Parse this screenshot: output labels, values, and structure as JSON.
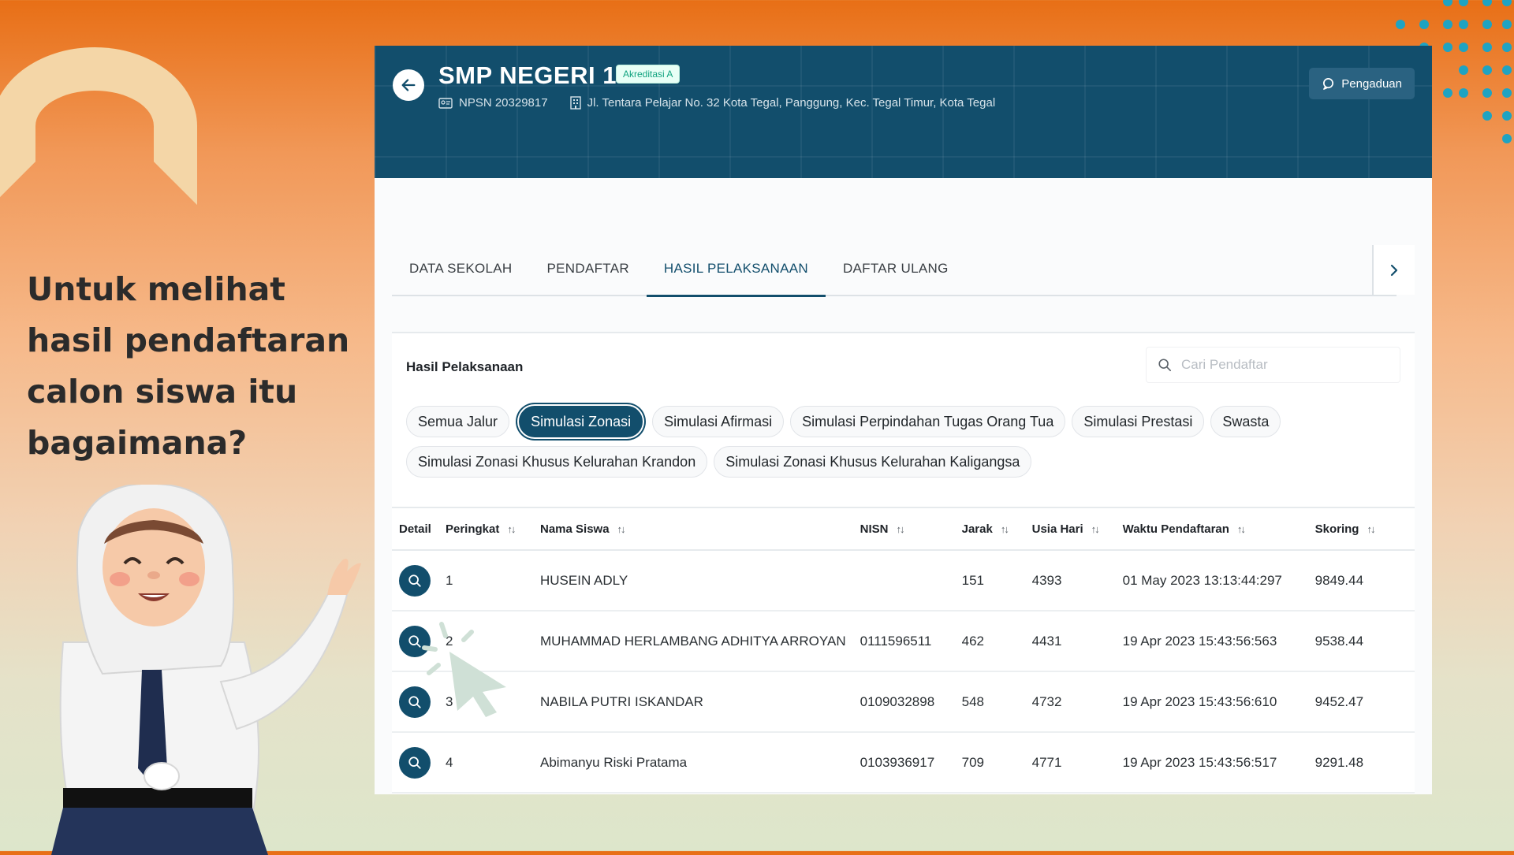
{
  "slide": {
    "headline": "Untuk melihat hasil pendaftaran calon siswa itu bagaimana?"
  },
  "header": {
    "school_name": "SMP NEGERI 1",
    "accreditation": "Akreditasi A",
    "npsn": "NPSN 20329817",
    "address": "Jl. Tentara Pelajar No. 32 Kota Tegal, Panggung, Kec. Tegal Timur, Kota Tegal",
    "complaint_label": "Pengaduan"
  },
  "tabs": [
    {
      "label": "DATA SEKOLAH"
    },
    {
      "label": "PENDAFTAR"
    },
    {
      "label": "HASIL PELAKSANAAN"
    },
    {
      "label": "DAFTAR ULANG"
    }
  ],
  "results": {
    "title": "Hasil Pelaksanaan",
    "search_placeholder": "Cari Pendaftar",
    "chips": [
      "Semua Jalur",
      "Simulasi Zonasi",
      "Simulasi Afirmasi",
      "Simulasi Perpindahan Tugas Orang Tua",
      "Simulasi Prestasi",
      "Swasta",
      "Simulasi Zonasi Khusus Kelurahan Krandon",
      "Simulasi Zonasi Khusus Kelurahan Kaligangsa"
    ],
    "selected_chip": "Simulasi Zonasi",
    "columns": [
      "Detail",
      "Peringkat",
      "Nama Siswa",
      "NISN",
      "Jarak",
      "Usia Hari",
      "Waktu Pendaftaran",
      "Skoring"
    ],
    "rows": [
      {
        "rank": "1",
        "name": "HUSEIN ADLY",
        "nisn": "",
        "distance": "151",
        "age_days": "4393",
        "time": "01 May 2023 13:13:44:297",
        "score": "9849.44"
      },
      {
        "rank": "2",
        "name": "MUHAMMAD HERLAMBANG ADHITYA ARROYAN",
        "nisn": "0111596511",
        "distance": "462",
        "age_days": "4431",
        "time": "19 Apr 2023 15:43:56:563",
        "score": "9538.44"
      },
      {
        "rank": "3",
        "name": "NABILA PUTRI ISKANDAR",
        "nisn": "0109032898",
        "distance": "548",
        "age_days": "4732",
        "time": "19 Apr 2023 15:43:56:610",
        "score": "9452.47"
      },
      {
        "rank": "4",
        "name": "Abimanyu Riski Pratama",
        "nisn": "0103936917",
        "distance": "709",
        "age_days": "4771",
        "time": "19 Apr 2023 15:43:56:517",
        "score": "9291.48"
      }
    ]
  },
  "colors": {
    "primary": "#124E6C",
    "accent_dots": "#1FA3C2",
    "accreditation": "#11A37F"
  }
}
